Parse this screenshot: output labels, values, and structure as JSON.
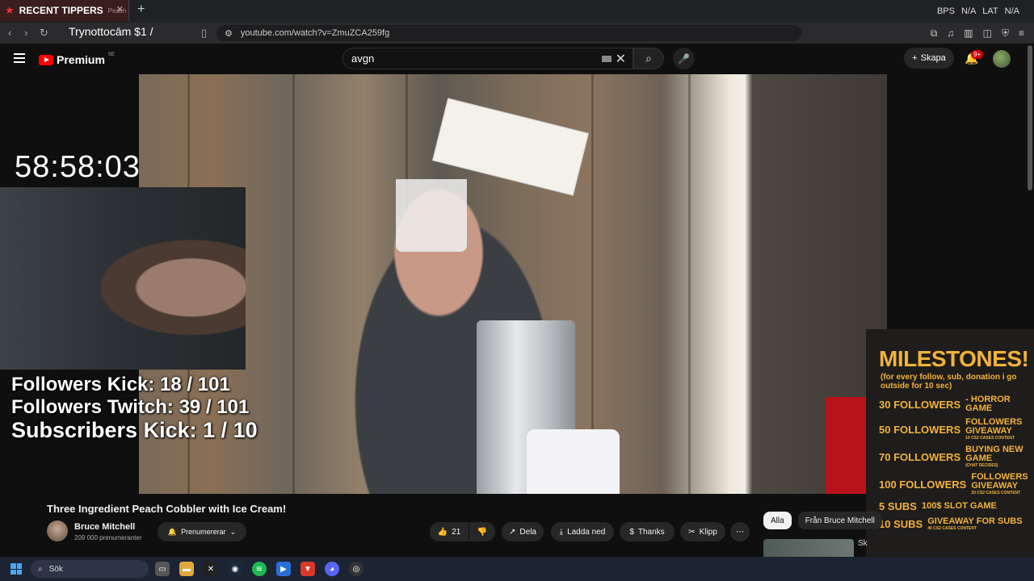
{
  "browser": {
    "tab": {
      "title": "RECENT TIPPERS",
      "subtitle": "Peach"
    },
    "overlay_text": "Trynottocām $1 /",
    "url": "youtube.com/watch?v=ZmuZCA259fg",
    "top_right": [
      "BPS",
      "N/A",
      "LAT",
      "N/A"
    ]
  },
  "youtube": {
    "logo_word": "Premium",
    "logo_region": "SE",
    "search_value": "avgn",
    "create_label": "Skapa",
    "notifications": "9+"
  },
  "stream": {
    "timer": "58:58:03",
    "stats": [
      "Followers Kick: 18 / 101",
      "Followers Twitch: 39 / 101",
      "Subscribers Kick: 1 / 10"
    ]
  },
  "milestones": {
    "title": "MILESTONES!",
    "subtitle": "(for every follow, sub, donation i go outside for 10 sec)",
    "rows": [
      {
        "left": "30 FOLLOWERS",
        "right": "- HORROR GAME",
        "small": ""
      },
      {
        "left": "50 FOLLOWERS",
        "right": "FOLLOWERS GIVEAWAY",
        "small": "10 CS2 CASES CONTENT"
      },
      {
        "left": "70 FOLLOWERS",
        "right": "BUYING NEW GAME",
        "small": "(CHAT DECIDES)"
      },
      {
        "left": "100 FOLLOWERS",
        "right": "FOLLOWERS GIVEAWAY",
        "small": "20 CS2 CASES CONTENT"
      },
      {
        "left": "5 SUBS",
        "right": "100$ SLOT GAME",
        "small": ""
      },
      {
        "left": "10 SUBS",
        "right": "GIVEAWAY FOR SUBS",
        "small": "40 CS2 CASES CONTENT"
      }
    ]
  },
  "video": {
    "title": "Three Ingredient Peach Cobbler with Ice Cream!",
    "channel": "Bruce Mitchell",
    "subscribers": "209 000 prenumeranter",
    "subscribe_label": "Prenumererar",
    "likes": "21",
    "share": "Dela",
    "download": "Ladda ned",
    "thanks": "Thanks",
    "clip": "Klipp",
    "more": "⋯"
  },
  "related": {
    "chips": [
      "Alla",
      "Från Bruce Mitchell"
    ],
    "next_title_fragment": "Sk\nPa"
  },
  "taskbar": {
    "search_placeholder": "Sök"
  },
  "colors": {
    "accent": "#f1b23b",
    "yt_red": "#ff0000",
    "bg": "#0f0f0f"
  }
}
